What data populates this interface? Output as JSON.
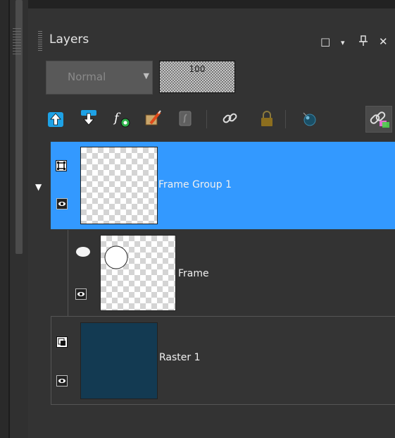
{
  "panel": {
    "title": "Layers",
    "window_buttons": {
      "maximize": "□",
      "dropdown": "▾",
      "pin": "ᵠ",
      "close": "✕"
    }
  },
  "controls": {
    "blend_mode": "Normal",
    "opacity": "100"
  },
  "toolbar": {
    "icons": [
      "move-layer-up-icon",
      "move-layer-down-icon",
      "fx-effects-icon",
      "edit-brush-icon",
      "script-icon",
      "link-icon",
      "lock-icon",
      "circle-mask-icon",
      "link-color-icon"
    ]
  },
  "layers": [
    {
      "name": "Frame Group 1",
      "type": "group",
      "selected": true,
      "expanded": true
    },
    {
      "name": "Frame",
      "type": "frame",
      "selected": false
    },
    {
      "name": "Raster 1",
      "type": "raster",
      "selected": false,
      "fill": "#133a52"
    }
  ],
  "colors": {
    "selection": "#3399ff",
    "panel_bg": "#333333",
    "raster_fill": "#133a52"
  }
}
